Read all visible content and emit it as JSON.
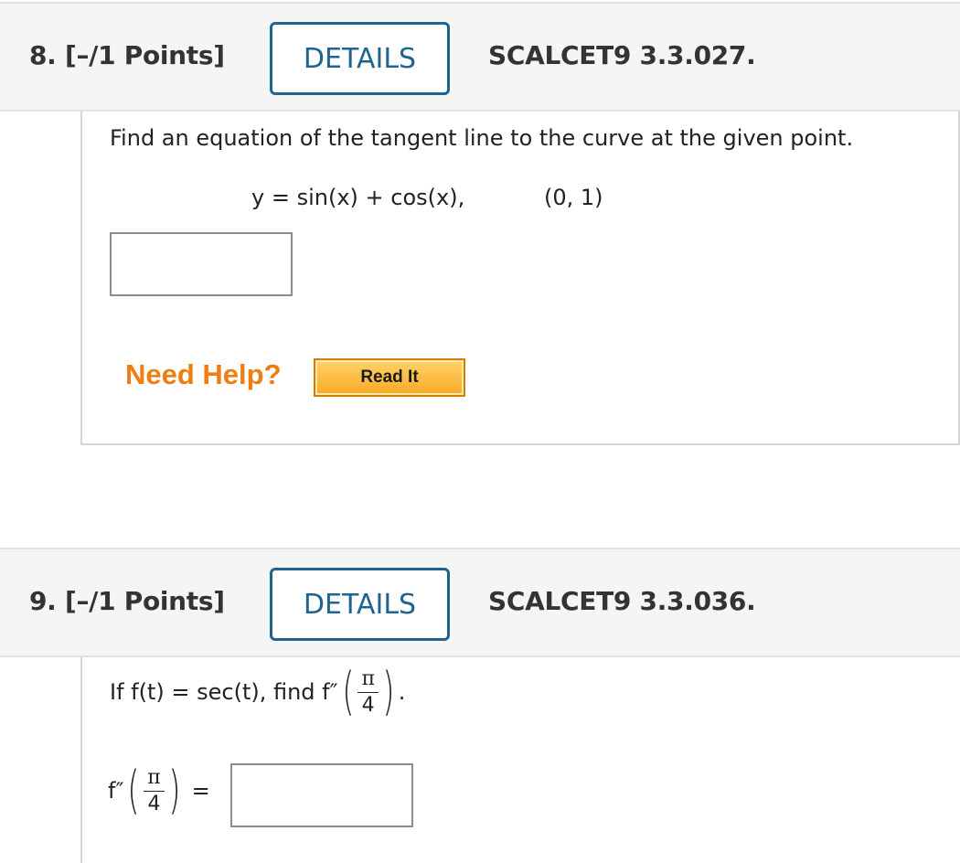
{
  "questions": [
    {
      "number_points": "8.  [–/1 Points]",
      "details_label": "DETAILS",
      "code": "SCALCET9 3.3.027.",
      "prompt": "Find an equation of the tangent line to the curve at the given point.",
      "equation": "y = sin(x) + cos(x),",
      "point": "(0, 1)",
      "answer_value": "",
      "need_help_label": "Need Help?",
      "read_it_label": "Read It"
    },
    {
      "number_points": "9.  [–/1 Points]",
      "details_label": "DETAILS",
      "code": "SCALCET9 3.3.036.",
      "prompt_prefix": "If f(t) = sec(t), find f″",
      "prompt_suffix": ".",
      "fraction_numerator": "π",
      "fraction_denominator": "4",
      "answer_label_func": "f″",
      "answer_equals": "=",
      "answer_value": ""
    }
  ]
}
